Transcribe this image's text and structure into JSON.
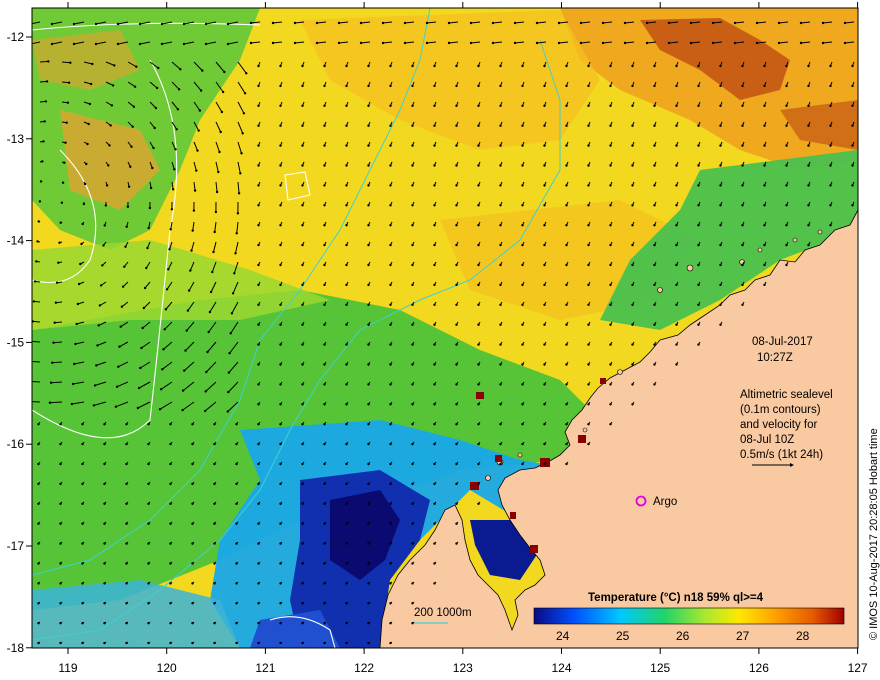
{
  "map": {
    "x_ticks": [
      "119",
      "120",
      "121",
      "122",
      "123",
      "124",
      "125",
      "126",
      "127"
    ],
    "y_ticks": [
      "-12",
      "-13",
      "-14",
      "-15",
      "-16",
      "-17",
      "-18"
    ],
    "land_color": "#f9c9a2",
    "ocean_color": "#e6dc14"
  },
  "annotation": {
    "date": "08-Jul-2017",
    "time": "10:27Z",
    "lines": [
      "Altimetric sealevel",
      "(0.1m contours)",
      "and velocity for",
      "08-Jul 10Z",
      "0.5m/s (1kt 24h)"
    ]
  },
  "argo_label": "Argo",
  "bathy_legend": "200  1000m",
  "colorbar": {
    "title": "Temperature (°C) n18 59% ql>=4",
    "ticks": [
      "24",
      "25",
      "26",
      "27",
      "28"
    ],
    "colors": [
      "#0a0a82",
      "#0050ff",
      "#00c8ff",
      "#20d46a",
      "#a8e830",
      "#ffe800",
      "#ffa000",
      "#e65a00",
      "#a00000"
    ]
  },
  "credit": "© IMOS 10-Aug-2017 20:28:05 Hobart time"
}
